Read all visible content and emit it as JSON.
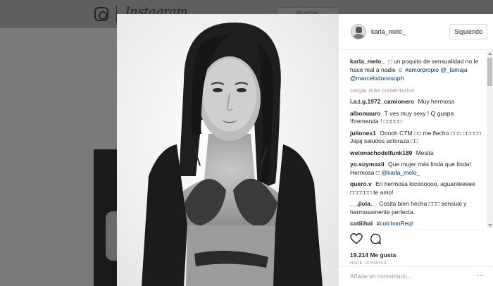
{
  "background": {
    "wordmark": "Instagram",
    "search_placeholder": "Buscar"
  },
  "post": {
    "username": "karla_melo_",
    "follow_label": "Siguiendo",
    "caption": {
      "user": "karla_melo_",
      "text": "□ un poquito de sensualidad no le hace mal a nadie ☺",
      "hashtag": "#amorpropio",
      "mention1": "@_lamaja",
      "mention2": "@marcelodonosoph"
    },
    "load_more": "cargar más comentarios",
    "comments": [
      {
        "user": "i.a.t.g.1972_camionero",
        "text": "Muy hermosa"
      },
      {
        "user": "albomauro",
        "text": "T ves muy sexy ! Q guapa !!tremenda ! □□□□□"
      },
      {
        "user": "julionex1",
        "text": "Ooooh CTM □□ me flecho □□□ □□□□□ Jajaj saludos actoraza □□"
      },
      {
        "user": "welonachodelfunk189",
        "text": "Mesita"
      },
      {
        "user": "yo.soymaxii",
        "text": "Que mujer más linda que linda! Hermosa □",
        "mention": "@karla_melo_"
      },
      {
        "user": "quero.v",
        "text": "Eri hermosa locoooooo, aguanteeeee □□□□□□ te amo!"
      },
      {
        "user": "__.jlola._",
        "text": "Cosita bien hecha □□□ sensual y hermosamente perfecta."
      },
      {
        "user": "cotiiihai",
        "text": "",
        "hashtag": "#colchonReql"
      }
    ],
    "likes": "19.214 Me gusta",
    "time": "HACE 13 HORAS",
    "add_comment_placeholder": "Añade un comentario...",
    "more_label": "···"
  }
}
